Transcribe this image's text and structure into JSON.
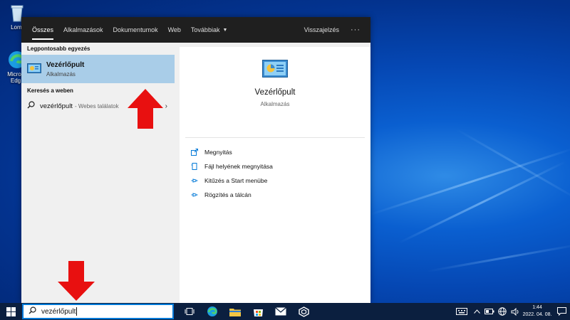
{
  "desktop": {
    "icons": [
      {
        "label": "Lomt",
        "icon": "recycle-bin-icon"
      },
      {
        "label": "Micros Edg",
        "icon": "edge-icon"
      }
    ]
  },
  "search_panel": {
    "tabs": [
      {
        "label": "Összes",
        "active": true
      },
      {
        "label": "Alkalmazások"
      },
      {
        "label": "Dokumentumok"
      },
      {
        "label": "Web"
      },
      {
        "label": "Továbbiak",
        "dropdown": true
      }
    ],
    "feedback_label": "Visszajelzés",
    "more_label": "···",
    "best_match_heading": "Legpontosabb egyezés",
    "best_match": {
      "title": "Vezérlőpult",
      "subtitle": "Alkalmazás",
      "icon": "control-panel-icon"
    },
    "web_heading": "Keresés a weben",
    "web_result": {
      "query": "vezérlőpult",
      "hint": "- Webes találatok"
    },
    "preview": {
      "title": "Vezérlőpult",
      "subtitle": "Alkalmazás"
    },
    "actions": [
      {
        "label": "Megnyitás",
        "icon": "open-icon"
      },
      {
        "label": "Fájl helyének megnyitása",
        "icon": "file-location-icon"
      },
      {
        "label": "Kitűzés a Start menübe",
        "icon": "pin-icon"
      },
      {
        "label": "Rögzítés a tálcán",
        "icon": "pin-taskbar-icon"
      }
    ]
  },
  "taskbar": {
    "search_value": "vezérlőpult",
    "clock_time": "1:44",
    "clock_date": "2022. 04. 08.",
    "pinned": [
      "task-view-icon",
      "edge-icon",
      "file-explorer-icon",
      "store-icon",
      "mail-icon",
      "app-icon"
    ]
  },
  "colors": {
    "accent": "#0078d7",
    "selection": "#a9cde8",
    "arrow": "#e81010",
    "taskbar": "#0b1f3f"
  }
}
